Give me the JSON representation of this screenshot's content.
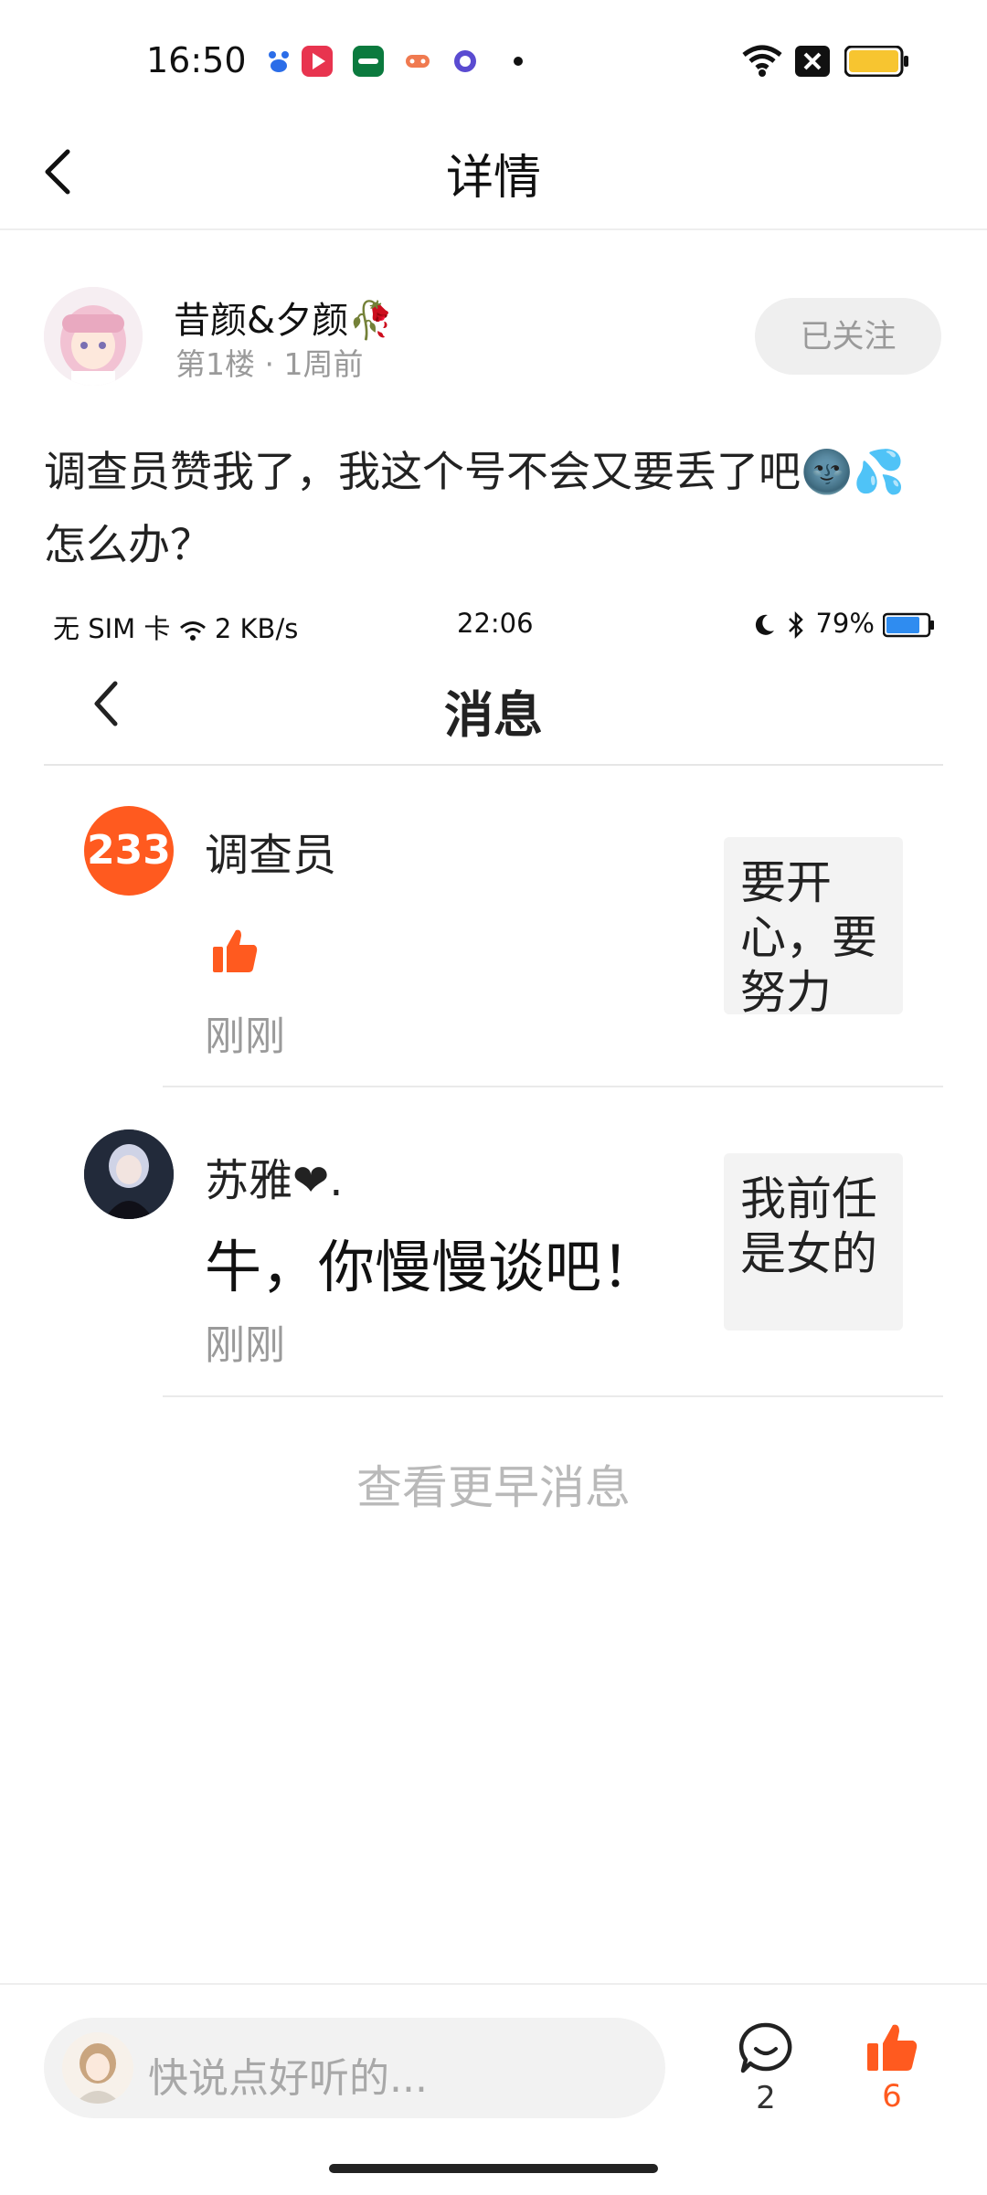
{
  "status_bar": {
    "time": "16:50",
    "colors": {
      "accent": "#ff5a1f",
      "battery": "#f7c530"
    }
  },
  "header": {
    "title": "详情",
    "back_icon": "chevron-left-icon"
  },
  "post": {
    "author": "昔颜&夕颜🥀",
    "floor": "第1楼",
    "time_ago": "1周前",
    "follow_label": "已关注",
    "text_line1": "调查员赞我了，我这个号不会又要丢了吧🌚💦",
    "text_line2": "怎么办？"
  },
  "embedded": {
    "status_left": "无 SIM 卡",
    "net_speed": "2 KB/s",
    "time": "22:06",
    "battery": "79%",
    "title": "消息",
    "messages": [
      {
        "name": "调查员",
        "avatar_text": "233",
        "content_icon": "thumbs-up-icon",
        "time": "刚刚",
        "thumb_text": "要开心，要努力"
      },
      {
        "name": "苏雅❤.",
        "text": "牛，你慢慢谈吧！",
        "time": "刚刚",
        "thumb_text": "我前任是女的"
      }
    ],
    "more_label": "查看更早消息"
  },
  "bottom_bar": {
    "input_placeholder": "快说点好听的...",
    "comment_count": "2",
    "like_count": "6"
  }
}
